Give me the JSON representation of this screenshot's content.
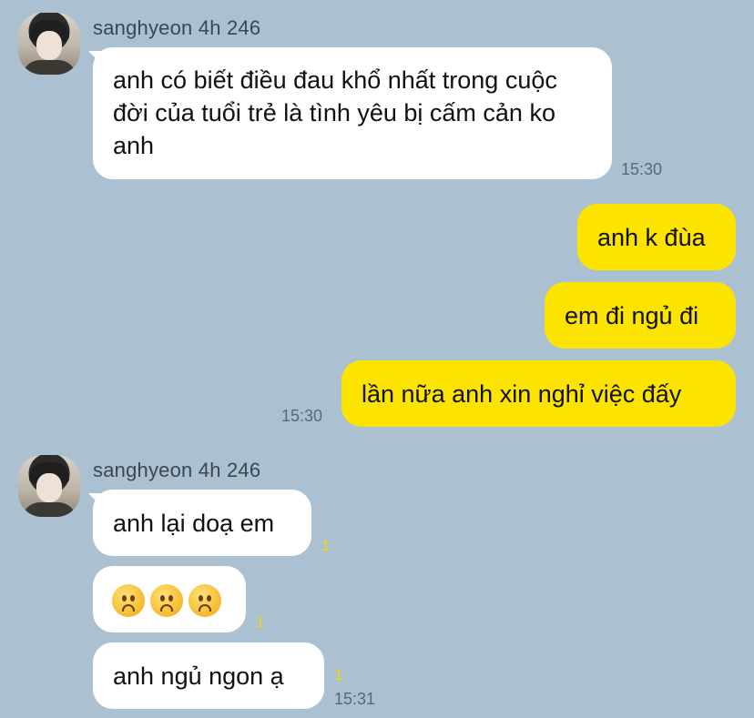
{
  "group1": {
    "sender": "sanghyeon 4h 246",
    "message": "anh có biết điều đau khổ nhất trong cuộc đời của tuổi trẻ là tình yêu bị cấm cản ko anh",
    "time": "15:30"
  },
  "outgoing": {
    "messages": [
      "anh k đùa",
      "em đi ngủ đi",
      "lần nữa anh xin nghỉ việc đấy"
    ],
    "time": "15:30"
  },
  "group2": {
    "sender": "sanghyeon 4h 246",
    "messages": [
      {
        "text": "anh lại doạ em",
        "unread": "1"
      },
      {
        "emoji": [
          "frowning-face-emoji",
          "frowning-face-emoji",
          "frowning-face-emoji"
        ],
        "unread": "1"
      },
      {
        "text": "anh ngủ ngon ạ",
        "unread": "1"
      }
    ],
    "time": "15:31"
  },
  "colors": {
    "background": "#abc1d1",
    "incoming": "#ffffff",
    "outgoing": "#fde400",
    "unread": "#f4d800"
  }
}
